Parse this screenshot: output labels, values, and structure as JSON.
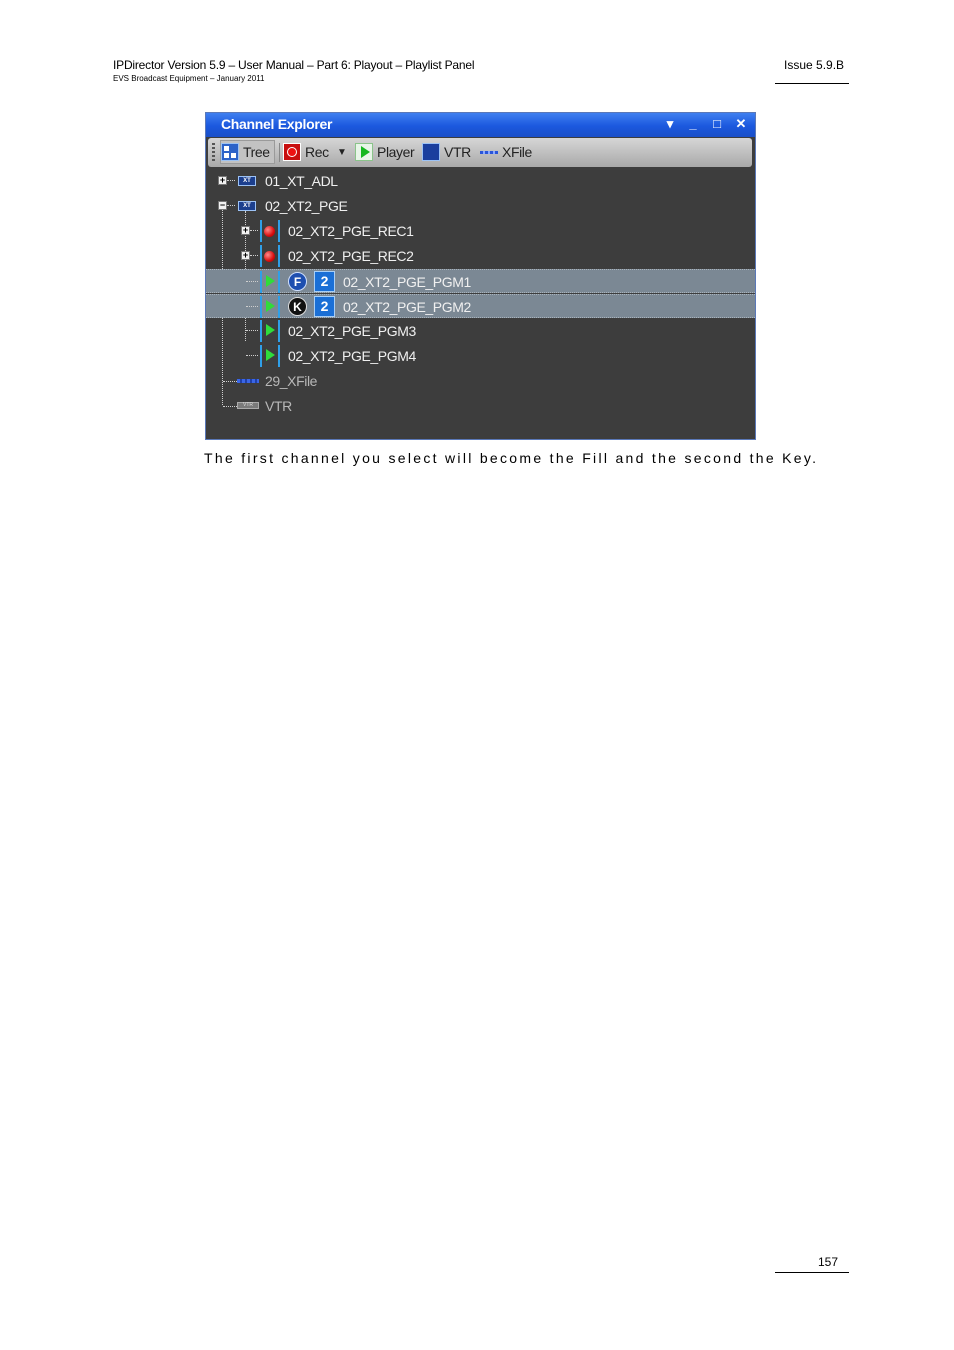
{
  "header": {
    "title": "IPDirector Version 5.9 – User Manual – Part 6: Playout – Playlist Panel",
    "subtitle": "EVS Broadcast Equipment – January 2011",
    "issue": "Issue 5.9.B"
  },
  "window": {
    "title": "Channel Explorer",
    "controls": {
      "dropdown": "▾",
      "minimize": "_",
      "maximize": "□",
      "close": "✕"
    },
    "toolbar": {
      "tree": "Tree",
      "rec": "Rec",
      "player": "Player",
      "vtr": "VTR",
      "xfile": "XFile"
    },
    "tree": [
      {
        "label": "01_XT_ADL"
      },
      {
        "label": "02_XT2_PGE"
      },
      {
        "label": "02_XT2_PGE_REC1"
      },
      {
        "label": "02_XT2_PGE_REC2"
      },
      {
        "label": "02_XT2_PGE_PGM1",
        "badge": "F",
        "number": "2"
      },
      {
        "label": "02_XT2_PGE_PGM2",
        "badge": "K",
        "number": "2"
      },
      {
        "label": "02_XT2_PGE_PGM3"
      },
      {
        "label": "02_XT2_PGE_PGM4"
      },
      {
        "label": "29_XFile"
      },
      {
        "label": "VTR"
      }
    ],
    "icon_text": {
      "xt": "XT",
      "vtr": "VTR"
    },
    "colors": {
      "titlebar": "#1b58de",
      "selection": "#7b8894",
      "tree_bg": "#3d3d3d"
    }
  },
  "caption": "The first channel you select will become the Fill and the second the Key.",
  "page_number": "157"
}
